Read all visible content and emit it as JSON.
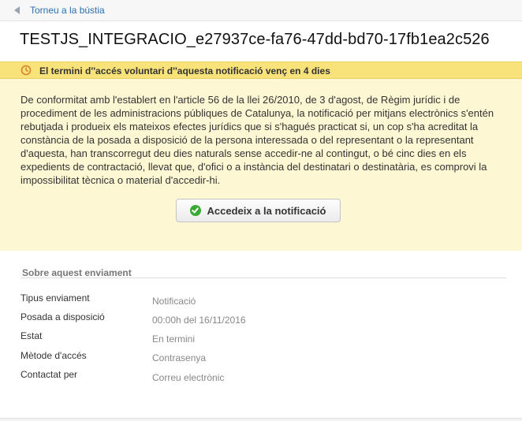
{
  "topbar": {
    "back_label": "Torneu a la bústia"
  },
  "notification": {
    "title": "TESTJS_INTEGRACIO_e27937ce-fa76-47dd-bd70-17fb1ea2c526",
    "warning": "El termini d''accés voluntari d''aquesta notificació venç en 4 dies",
    "body": "De conformitat amb l'establert en l'article 56 de la llei 26/2010, de 3 d'agost, de Règim jurídic i de procediment de les administracions públiques de Catalunya, la notificació per mitjans electrònics s'entén rebutjada i produeix els mateixos efectes jurídics que si s'hagués practicat si, un cop s'ha acreditat la constància de la posada a disposició de la persona interessada o del representant o la representant d'aquesta, han transcorregut deu dies naturals sense accedir-ne al contingut, o bé cinc dies en els expedients de contractació, llevat que, d'ofici o a instància del destinatari o destinatària, es comprovi la impossibilitat tècnica o material d'accedir-hi.",
    "access_button": "Accedeix a la notificació"
  },
  "details": {
    "section_title": "Sobre aquest enviament",
    "rows": [
      {
        "label": "Tipus enviament",
        "value": "Notificació"
      },
      {
        "label": "Posada a disposició",
        "value": "00:00h del 16/11/2016"
      },
      {
        "label": "Estat",
        "value": "En termini"
      },
      {
        "label": "Mètode d'accés",
        "value": "Contrasenya"
      },
      {
        "label": "Contactat per",
        "value": "Correu electrònic"
      }
    ]
  },
  "colors": {
    "warning_bar": "#f8e27a",
    "notice_background": "#fdf7d3",
    "link": "#2a6fb0",
    "check": "#3aaa35"
  },
  "icons": {
    "back": "back-arrow-icon",
    "warning": "clock-icon",
    "button": "check-circle-icon"
  }
}
